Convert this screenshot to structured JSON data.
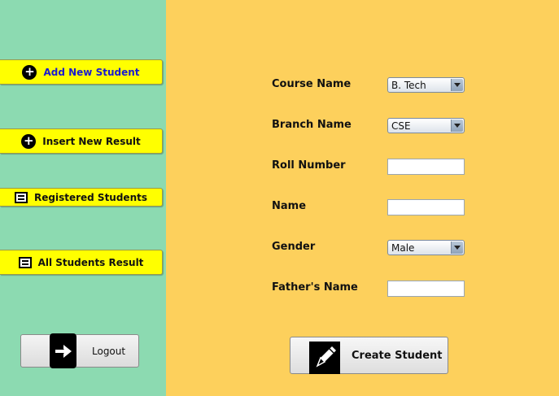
{
  "sidebar": {
    "background": "#8cdab1",
    "items": [
      {
        "label": "Add New Student",
        "icon": "plus-circle-icon"
      },
      {
        "label": "Insert New Result",
        "icon": "plus-circle-icon"
      },
      {
        "label": "Registered Students",
        "icon": "list-icon"
      },
      {
        "label": "All Students Result",
        "icon": "list-icon"
      }
    ],
    "logout_label": "Logout"
  },
  "form": {
    "background": "#fdd05c",
    "course_name": {
      "label": "Course Name",
      "value": "B. Tech"
    },
    "branch_name": {
      "label": "Branch Name",
      "value": "CSE"
    },
    "roll_number": {
      "label": "Roll Number",
      "value": ""
    },
    "name": {
      "label": "Name",
      "value": ""
    },
    "gender": {
      "label": "Gender",
      "value": "Male"
    },
    "fathers_name": {
      "label": "Father's Name",
      "value": ""
    },
    "submit_label": "Create Student"
  }
}
